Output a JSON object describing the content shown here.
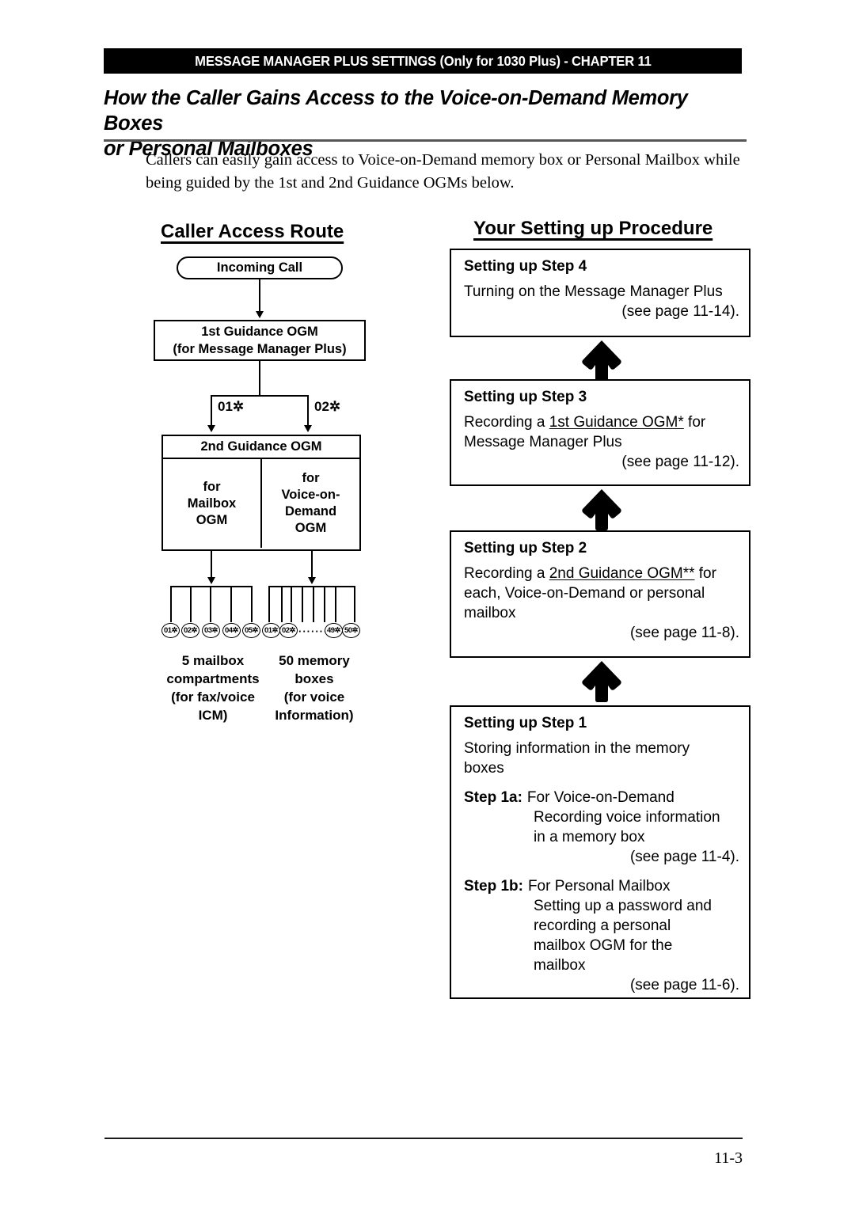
{
  "header": {
    "banner": "MESSAGE MANAGER PLUS SETTINGS (Only for 1030 Plus) - CHAPTER 11"
  },
  "section": {
    "heading_line1": "How the Caller Gains Access to the Voice-on-Demand Memory Boxes",
    "heading_line2": "or Personal Mailboxes",
    "intro_line1": "Callers can easily gain access to Voice-on-Demand memory box or Personal Mailbox while",
    "intro_line2": "being guided by the 1st and 2nd Guidance OGMs below."
  },
  "left_column": {
    "title": "Caller Access Route",
    "incoming_call": "Incoming Call",
    "first_guidance": {
      "line1": "1st Guidance OGM",
      "line2": "(for Message Manager Plus)"
    },
    "branch_labels": {
      "left": "01✲",
      "right": "02✲"
    },
    "second_guidance": {
      "header": "2nd Guidance OGM",
      "left_cell": [
        "for",
        "Mailbox",
        "OGM"
      ],
      "right_cell": [
        "for",
        "Voice-on-",
        "Demand",
        "OGM"
      ]
    },
    "mailbox_chips": [
      "01✲",
      "02✲",
      "03✲",
      "04✲",
      "05✲"
    ],
    "memory_chips_start": [
      "01✲",
      "02✲"
    ],
    "memory_chips_end": [
      "49✲",
      "50✲"
    ],
    "memory_chips_ellipsis": "········",
    "caption_left": [
      "5 mailbox",
      "compartments",
      "(for fax/voice",
      "ICM)"
    ],
    "caption_right": [
      "50 memory",
      "boxes",
      "(for voice",
      "Information)"
    ]
  },
  "right_column": {
    "title": "Your Setting up Procedure",
    "steps": [
      {
        "title": "Setting up Step 4",
        "body_line1": "Turning on the Message Manager Plus",
        "page_ref": "(see page 11-14)."
      },
      {
        "title": "Setting up Step 3",
        "body_prefix": "Recording a ",
        "body_underlined": "1st Guidance OGM*",
        "body_suffix": " for",
        "body_line2": "Message Manager Plus",
        "page_ref": "(see page 11-12)."
      },
      {
        "title": "Setting up Step 2",
        "body_prefix": "Recording a ",
        "body_underlined": "2nd Guidance OGM**",
        "body_suffix": " for",
        "body_line2": "each, Voice-on-Demand or personal",
        "body_line3": "mailbox",
        "page_ref": "(see page 11-8)."
      },
      {
        "title": "Setting up Step 1",
        "body_line1": "Storing information in the memory",
        "body_line2": "boxes",
        "substep_a": {
          "label": "Step 1a:",
          "line1": "For Voice-on-Demand",
          "line2": "Recording voice information",
          "line3": "in a memory box",
          "page_ref": "(see page 11-4)."
        },
        "substep_b": {
          "label": "Step 1b:",
          "line1": "For Personal Mailbox",
          "line2": "Setting up a password and",
          "line3": "recording a personal",
          "line4": "mailbox OGM for the",
          "line5": "mailbox",
          "page_ref": "(see page 11-6)."
        }
      }
    ]
  },
  "footer": {
    "page_number": "11-3"
  }
}
